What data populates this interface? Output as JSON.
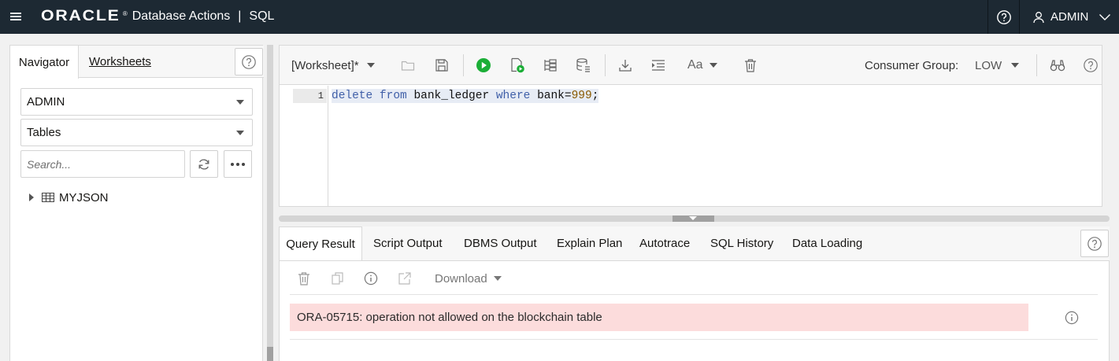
{
  "topbar": {
    "logo": "ORACLE",
    "reg_mark": "®",
    "app_name": "Database Actions",
    "separator": "|",
    "page_name": "SQL",
    "user": "ADMIN",
    "bg_color": "#1d2933"
  },
  "navigator": {
    "tabs": [
      "Navigator",
      "Worksheets"
    ],
    "schema_select": "ADMIN",
    "object_type_select": "Tables",
    "search_placeholder": "Search...",
    "tree_items": [
      {
        "label": "MYJSON",
        "icon": "table-icon"
      }
    ]
  },
  "worksheet": {
    "name": "[Worksheet]*",
    "consumer_group_label": "Consumer Group:",
    "consumer_group_value": "LOW",
    "font_label": "Aa",
    "line_number": "1",
    "code": {
      "kw1": "delete",
      "kw2": "from",
      "table": "bank_ledger",
      "kw3": "where",
      "col": "bank=",
      "num": "999",
      "end": ";"
    }
  },
  "results": {
    "tabs": [
      "Query Result",
      "Script Output",
      "DBMS Output",
      "Explain Plan",
      "Autotrace",
      "SQL History",
      "Data Loading"
    ],
    "download_label": "Download",
    "error_message": "ORA-05715: operation not allowed on the blockchain table",
    "error_bg": "#fcdcdc"
  }
}
